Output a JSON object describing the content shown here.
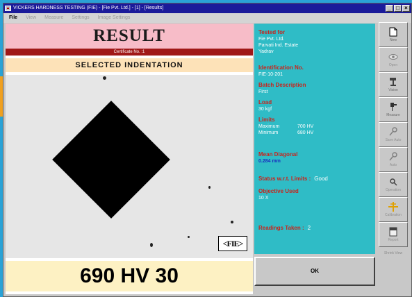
{
  "window": {
    "title": "VICKERS HARDNESS TESTING (FIE) - [Fie Pvt. Ltd.] - [1] - [Results]",
    "controls": [
      "_",
      "□",
      "×"
    ]
  },
  "menu": [
    "File",
    "View",
    "Measure",
    "Settings",
    "Image Settings"
  ],
  "result": {
    "title": "RESULT",
    "certificate": "Certificate No. :1",
    "indentation_header": "SELECTED INDENTATION",
    "logo_text": "<FIE>",
    "hardness": "690 HV 30"
  },
  "info": {
    "tested_for_label": "Tested for",
    "tested_for": [
      "Fie Pvt. Ltd.",
      "Parvati Ind. Estate",
      "Yadrav"
    ],
    "identification_label": "Identification No.",
    "identification": "FIE-10-201",
    "batch_label": "Batch Description",
    "batch": "First",
    "load_label": "Load",
    "load": "30 kgf",
    "limits_label": "Limits",
    "limits": [
      {
        "name": "Maximum",
        "value": "700 HV"
      },
      {
        "name": "Minimum",
        "value": "680 HV"
      }
    ],
    "mean_diagonal_label": "Mean Diagonal",
    "mean_diagonal": "0.284 mm",
    "status_label": "Status w.r.t. Limits :",
    "status": "Good",
    "objective_label": "Objective Used",
    "objective": "10 X",
    "readings_label": "Readings Taken :",
    "readings": "2"
  },
  "ok_button": "OK",
  "toolbar": {
    "items": [
      {
        "label": "New",
        "icon": "new-document-icon",
        "enabled": true
      },
      {
        "label": "Open",
        "icon": "open-eye-icon",
        "enabled": false
      },
      {
        "label": "Vision",
        "icon": "microscope-icon",
        "enabled": true
      },
      {
        "label": "Measure",
        "icon": "measure-probe-icon",
        "enabled": true
      },
      {
        "label": "Save Auto",
        "icon": "save-auto-icon",
        "enabled": false
      },
      {
        "label": "Auto",
        "icon": "auto-icon",
        "enabled": false
      },
      {
        "label": "Operation",
        "icon": "zoom-icon",
        "enabled": false
      },
      {
        "label": "Calibration",
        "icon": "calibration-crosshair-icon",
        "enabled": false
      },
      {
        "label": "Report",
        "icon": "report-icon",
        "enabled": false
      }
    ],
    "hardcopy_label": "Shrink View"
  },
  "colors": {
    "title_pink": "#f7bcc8",
    "cert_red": "#a01818",
    "info_teal": "#2fbcc6",
    "label_red": "#c8241c",
    "value_blue": "#1a2fbf",
    "hv_yellow": "#fdf1c3"
  }
}
